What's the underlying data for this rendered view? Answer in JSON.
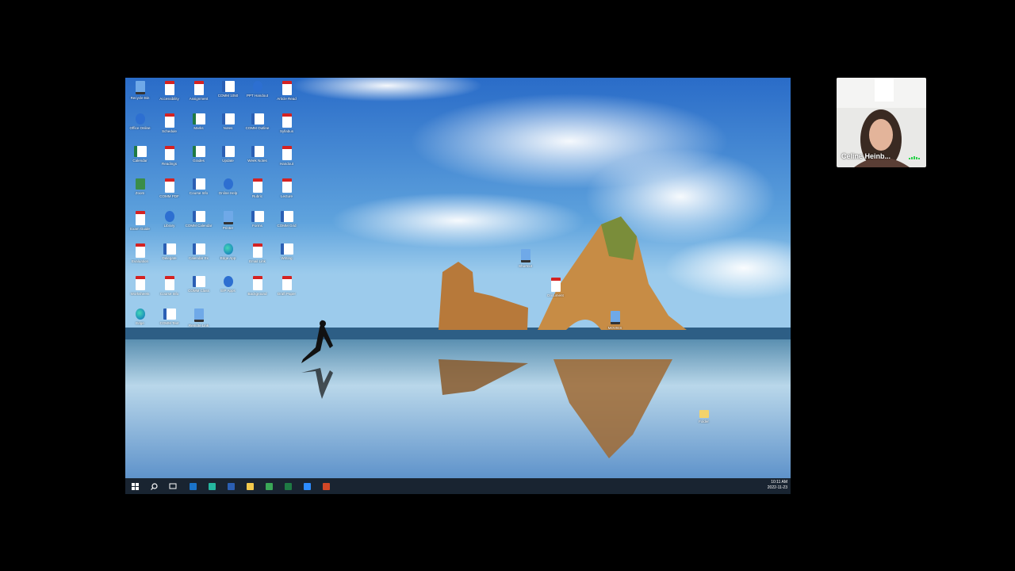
{
  "desktop": {
    "icons": [
      {
        "label": "Recycle Bin",
        "type": "pc"
      },
      {
        "label": "Accessibility",
        "type": "pdf"
      },
      {
        "label": "Assignment",
        "type": "pdf"
      },
      {
        "label": "COMM 1050",
        "type": "doc"
      },
      {
        "label": "PPT Handout",
        "type": "app"
      },
      {
        "label": "Article Read",
        "type": "pdf"
      },
      {
        "label": "Office Online",
        "type": "app"
      },
      {
        "label": "Schedule",
        "type": "pdf"
      },
      {
        "label": "Marks",
        "type": "xls"
      },
      {
        "label": "Notes",
        "type": "doc"
      },
      {
        "label": "COMM Outline",
        "type": "doc"
      },
      {
        "label": "Syllabus",
        "type": "pdf"
      },
      {
        "label": "Calendar",
        "type": "xls"
      },
      {
        "label": "Readings",
        "type": "pdf"
      },
      {
        "label": "Grades",
        "type": "xls"
      },
      {
        "label": "Update",
        "type": "doc"
      },
      {
        "label": "Week Notes",
        "type": "doc"
      },
      {
        "label": "Handout",
        "type": "pdf"
      },
      {
        "label": "Zoom",
        "type": "ap"
      },
      {
        "label": "COMM PDF",
        "type": "pdf"
      },
      {
        "label": "Course Info",
        "type": "doc"
      },
      {
        "label": "Online Help",
        "type": "app"
      },
      {
        "label": "Rubric",
        "type": "pdf"
      },
      {
        "label": "Lecture",
        "type": "pdf"
      },
      {
        "label": "Exam Guide",
        "type": "pdf"
      },
      {
        "label": "Library",
        "type": "app"
      },
      {
        "label": "COMM Calendar",
        "type": "doc"
      },
      {
        "label": "Printer",
        "type": "pc"
      },
      {
        "label": "Forms",
        "type": "doc"
      },
      {
        "label": "COMM Grid",
        "type": "doc"
      },
      {
        "label": "Evaluation",
        "type": "pdf"
      },
      {
        "label": "Delegate",
        "type": "doc"
      },
      {
        "label": "Calendar Ex",
        "type": "doc"
      },
      {
        "label": "Edge App",
        "type": "edge"
      },
      {
        "label": "Email Link",
        "type": "pdf"
      },
      {
        "label": "Writing",
        "type": "doc"
      },
      {
        "label": "Worksheets",
        "type": "pdf"
      },
      {
        "label": "Course Info",
        "type": "pdf"
      },
      {
        "label": "COMM Class",
        "type": "doc"
      },
      {
        "label": "EIP Apps",
        "type": "app"
      },
      {
        "label": "Background",
        "type": "pdf"
      },
      {
        "label": "Draft Paper",
        "type": "pdf"
      },
      {
        "label": "Edge",
        "type": "edge"
      },
      {
        "label": "COMM Text",
        "type": "doc"
      },
      {
        "label": "Remote Link",
        "type": "pc"
      }
    ],
    "extra_icons": [
      {
        "label": "Shortcut",
        "type": "pc"
      },
      {
        "label": "Document",
        "type": "pdf"
      },
      {
        "label": "MOVIES",
        "type": "pc"
      },
      {
        "label": "Folder",
        "type": "fold"
      }
    ]
  },
  "taskbar": {
    "start": "start-icon",
    "search": "search-icon",
    "taskview": "task-view-icon",
    "apps": [
      {
        "name": "outlook-icon",
        "color": "#1a73c9"
      },
      {
        "name": "edge-icon",
        "color": "#25b7a0"
      },
      {
        "name": "word-icon",
        "color": "#2b5fb4"
      },
      {
        "name": "file-explorer-icon",
        "color": "#f2c94c"
      },
      {
        "name": "chrome-icon",
        "color": "#3aa757"
      },
      {
        "name": "excel-icon",
        "color": "#1f7a44"
      },
      {
        "name": "zoom-icon",
        "color": "#2d8cff"
      },
      {
        "name": "powerpoint-icon",
        "color": "#d24726"
      }
    ],
    "time": "10:11 AM",
    "date": "2022-11-23"
  },
  "participant": {
    "name": "Celine Heinb..."
  }
}
